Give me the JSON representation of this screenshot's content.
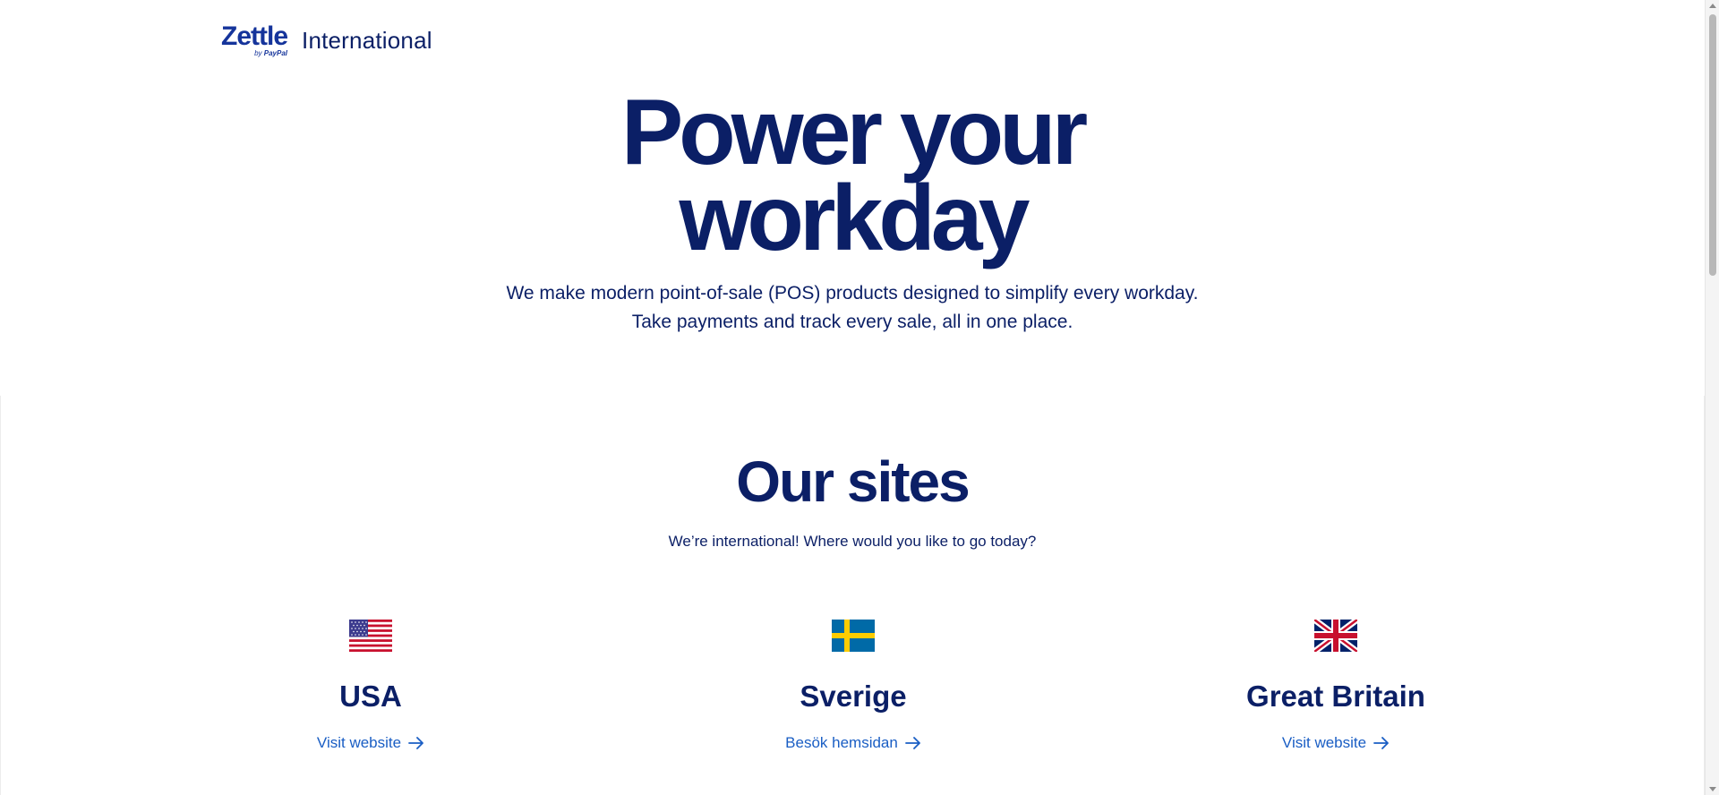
{
  "header": {
    "logo_word": "Zettle",
    "logo_by": "by",
    "logo_brand": "PayPal",
    "title": "International"
  },
  "hero": {
    "title_line1": "Power your",
    "title_line2": "workday",
    "desc_line1": "We make modern point-of-sale (POS) products designed to simplify every workday.",
    "desc_line2": "Take payments and track every sale, all in one place."
  },
  "sites": {
    "title": "Our sites",
    "subtitle": "We’re international! Where would you like to go today?",
    "items": [
      {
        "name": "USA",
        "link": "Visit website",
        "flag": "us-flag-icon"
      },
      {
        "name": "Sverige",
        "link": "Besök hemsidan",
        "flag": "sweden-flag-icon"
      },
      {
        "name": "Great Britain",
        "link": "Visit website",
        "flag": "uk-flag-icon"
      }
    ]
  },
  "colors": {
    "text_navy": "#0b1f66",
    "link_blue": "#1a5ec4",
    "logo_blue": "#15349b"
  }
}
